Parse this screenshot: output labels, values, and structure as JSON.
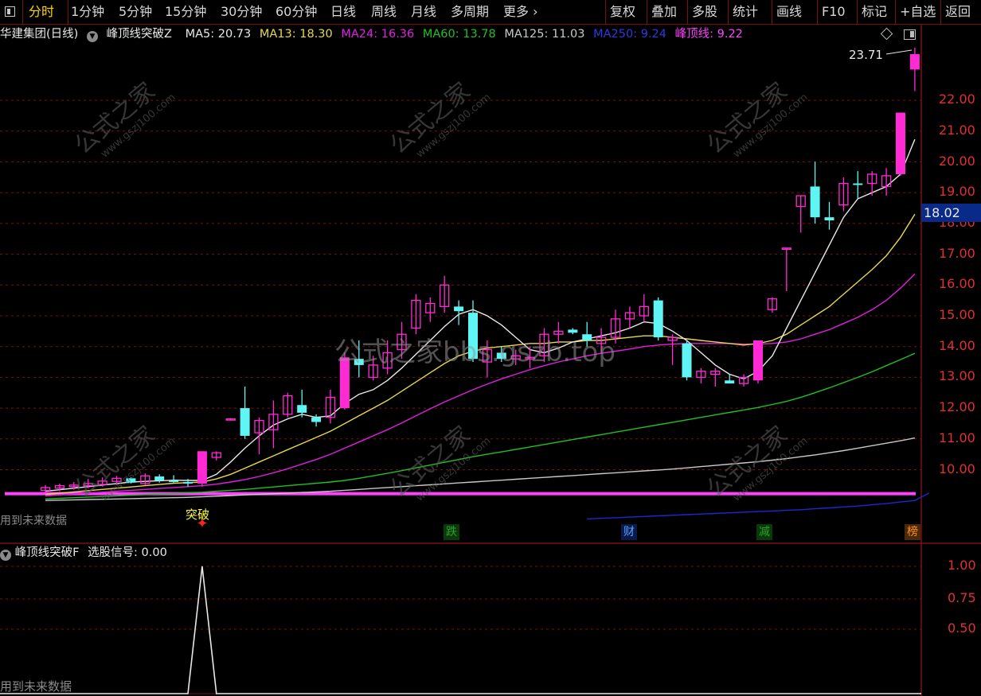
{
  "toolbar": {
    "items": [
      {
        "label": "分时",
        "active": true
      },
      {
        "label": "1分钟"
      },
      {
        "label": "5分钟"
      },
      {
        "label": "15分钟"
      },
      {
        "label": "30分钟"
      },
      {
        "label": "60分钟"
      },
      {
        "label": "日线"
      },
      {
        "label": "周线"
      },
      {
        "label": "月线"
      },
      {
        "label": "多周期"
      },
      {
        "label": "更多"
      }
    ],
    "more_arrow": "›",
    "right_items": [
      "复权",
      "叠加",
      "多股",
      "统计",
      "画线",
      "F10",
      "标记",
      "+自选",
      "返回"
    ]
  },
  "info": {
    "stock": "华建集团(日线)",
    "indicator": "峰顶线突破Z",
    "ma5": "MA5: 20.73",
    "ma13": "MA13: 18.30",
    "ma24": "MA24: 16.36",
    "ma60": "MA60: 13.78",
    "ma125": "MA125: 11.03",
    "ma250": "MA250: 9.24",
    "fengding": "峰顶线: 9.22",
    "dropdown_icon": "chevron-down"
  },
  "colors": {
    "up": "#ff2ad4",
    "down": "#5ff5f5",
    "ma5": "#e8e8e8",
    "ma13": "#e6d84a",
    "ma24": "#e020e0",
    "ma60": "#20c020",
    "ma125": "#c8c8c8",
    "ma250": "#1a2ad0",
    "fengding": "#ff40ff",
    "grid": "#7a1010",
    "axis": "#e03030"
  },
  "main_axis": {
    "labels": [
      "22.00",
      "21.00",
      "20.00",
      "19.00",
      "18.00",
      "17.00",
      "16.00",
      "15.00",
      "14.00",
      "13.00",
      "12.00",
      "11.00",
      "10.00"
    ],
    "current_price": "18.02"
  },
  "peak_label": "23.71",
  "breakout_label": "突破",
  "main_footnote": "用到未来数据",
  "news_badges": [
    {
      "text": "跌",
      "color": "#2ca02c",
      "bg": "#0a3a0a"
    },
    {
      "text": "财",
      "color": "#5aa0ff",
      "bg": "#0a1a4a"
    },
    {
      "text": "减",
      "color": "#2ca02c",
      "bg": "#0a3a0a"
    },
    {
      "text": "榜",
      "color": "#ff8c20",
      "bg": "#4a2a0a"
    }
  ],
  "sub": {
    "title": "峰顶线突破F",
    "signal": "选股信号: 0.00",
    "axis_labels": [
      "1.00",
      "0.75",
      "0.50"
    ],
    "footnote": "用到未来数据"
  },
  "watermark": {
    "center": "公式之家bbs.gszb.top",
    "diag_big": "公式之家",
    "diag_small": "www.gszj100.com"
  },
  "chart_data": {
    "type": "candlestick",
    "price_range": [
      9.0,
      23.71
    ],
    "candles": [
      {
        "o": 9.33,
        "h": 9.5,
        "l": 9.25,
        "c": 9.42
      },
      {
        "o": 9.4,
        "h": 9.55,
        "l": 9.3,
        "c": 9.48
      },
      {
        "o": 9.45,
        "h": 9.6,
        "l": 9.35,
        "c": 9.5
      },
      {
        "o": 9.48,
        "h": 9.7,
        "l": 9.4,
        "c": 9.55
      },
      {
        "o": 9.52,
        "h": 9.75,
        "l": 9.45,
        "c": 9.63
      },
      {
        "o": 9.62,
        "h": 9.8,
        "l": 9.5,
        "c": 9.72
      },
      {
        "o": 9.72,
        "h": 9.75,
        "l": 9.55,
        "c": 9.58
      },
      {
        "o": 9.55,
        "h": 9.88,
        "l": 9.5,
        "c": 9.8
      },
      {
        "o": 9.78,
        "h": 9.85,
        "l": 9.58,
        "c": 9.65
      },
      {
        "o": 9.65,
        "h": 9.82,
        "l": 9.58,
        "c": 9.6
      },
      {
        "o": 9.6,
        "h": 9.7,
        "l": 9.45,
        "c": 9.55
      },
      {
        "o": 9.55,
        "h": 10.6,
        "l": 9.45,
        "c": 10.6
      },
      {
        "o": 10.4,
        "h": 10.6,
        "l": 10.3,
        "c": 10.55
      },
      {
        "o": 11.65,
        "h": 11.68,
        "l": 11.6,
        "c": 11.65
      },
      {
        "o": 12.0,
        "h": 12.7,
        "l": 11.0,
        "c": 11.1
      },
      {
        "o": 11.2,
        "h": 11.7,
        "l": 10.5,
        "c": 11.6
      },
      {
        "o": 11.3,
        "h": 12.25,
        "l": 10.7,
        "c": 11.8
      },
      {
        "o": 11.8,
        "h": 12.5,
        "l": 11.7,
        "c": 12.4
      },
      {
        "o": 12.1,
        "h": 12.6,
        "l": 11.7,
        "c": 11.85
      },
      {
        "o": 11.7,
        "h": 11.8,
        "l": 11.4,
        "c": 11.55
      },
      {
        "o": 11.7,
        "h": 12.6,
        "l": 11.5,
        "c": 12.35
      },
      {
        "o": 12.0,
        "h": 13.8,
        "l": 11.95,
        "c": 13.65
      },
      {
        "o": 13.6,
        "h": 14.2,
        "l": 13.0,
        "c": 13.4
      },
      {
        "o": 13.0,
        "h": 13.7,
        "l": 12.9,
        "c": 13.4
      },
      {
        "o": 13.3,
        "h": 14.2,
        "l": 13.1,
        "c": 13.8
      },
      {
        "o": 13.9,
        "h": 14.8,
        "l": 13.6,
        "c": 14.4
      },
      {
        "o": 14.6,
        "h": 15.7,
        "l": 14.4,
        "c": 15.5
      },
      {
        "o": 15.1,
        "h": 15.6,
        "l": 14.8,
        "c": 15.4
      },
      {
        "o": 15.3,
        "h": 16.3,
        "l": 15.1,
        "c": 16.0
      },
      {
        "o": 15.3,
        "h": 15.5,
        "l": 14.7,
        "c": 15.15
      },
      {
        "o": 15.1,
        "h": 15.5,
        "l": 13.5,
        "c": 13.6
      },
      {
        "o": 13.5,
        "h": 14.2,
        "l": 13.0,
        "c": 13.9
      },
      {
        "o": 13.8,
        "h": 14.0,
        "l": 13.5,
        "c": 13.6
      },
      {
        "o": 13.6,
        "h": 13.9,
        "l": 13.4,
        "c": 13.7
      },
      {
        "o": 13.6,
        "h": 14.0,
        "l": 13.3,
        "c": 13.65
      },
      {
        "o": 13.7,
        "h": 14.6,
        "l": 13.5,
        "c": 14.4
      },
      {
        "o": 14.4,
        "h": 14.8,
        "l": 14.1,
        "c": 14.5
      },
      {
        "o": 14.55,
        "h": 14.6,
        "l": 14.4,
        "c": 14.45
      },
      {
        "o": 14.4,
        "h": 14.8,
        "l": 14.0,
        "c": 14.2
      },
      {
        "o": 14.1,
        "h": 14.6,
        "l": 13.8,
        "c": 14.3
      },
      {
        "o": 14.3,
        "h": 15.2,
        "l": 14.1,
        "c": 14.9
      },
      {
        "o": 14.9,
        "h": 15.3,
        "l": 14.6,
        "c": 15.1
      },
      {
        "o": 15.0,
        "h": 15.7,
        "l": 14.8,
        "c": 15.3
      },
      {
        "o": 15.5,
        "h": 15.6,
        "l": 14.2,
        "c": 14.3
      },
      {
        "o": 14.2,
        "h": 14.4,
        "l": 13.4,
        "c": 14.3
      },
      {
        "o": 14.1,
        "h": 14.2,
        "l": 12.9,
        "c": 13.0
      },
      {
        "o": 13.0,
        "h": 13.3,
        "l": 12.8,
        "c": 13.2
      },
      {
        "o": 13.1,
        "h": 13.3,
        "l": 12.7,
        "c": 13.2
      },
      {
        "o": 12.9,
        "h": 13.1,
        "l": 12.8,
        "c": 12.8
      },
      {
        "o": 12.8,
        "h": 13.1,
        "l": 12.7,
        "c": 13.0
      },
      {
        "o": 12.9,
        "h": 14.2,
        "l": 12.8,
        "c": 14.2
      },
      {
        "o": 15.2,
        "h": 15.6,
        "l": 15.1,
        "c": 15.55
      },
      {
        "o": 17.2,
        "h": 17.2,
        "l": 15.8,
        "c": 17.2
      },
      {
        "o": 18.55,
        "h": 18.9,
        "l": 17.7,
        "c": 18.9
      },
      {
        "o": 19.2,
        "h": 20.0,
        "l": 18.0,
        "c": 18.2
      },
      {
        "o": 18.2,
        "h": 18.7,
        "l": 17.8,
        "c": 18.1
      },
      {
        "o": 18.6,
        "h": 19.5,
        "l": 18.4,
        "c": 19.3
      },
      {
        "o": 19.3,
        "h": 19.7,
        "l": 18.8,
        "c": 19.25
      },
      {
        "o": 19.3,
        "h": 19.7,
        "l": 18.9,
        "c": 19.6
      },
      {
        "o": 19.2,
        "h": 19.8,
        "l": 18.9,
        "c": 19.55
      },
      {
        "o": 19.6,
        "h": 21.6,
        "l": 19.55,
        "c": 21.6
      },
      {
        "o": 23.0,
        "h": 23.71,
        "l": 22.3,
        "c": 23.5
      }
    ],
    "ma": {
      "ma5": [
        9.3,
        9.35,
        9.4,
        9.45,
        9.5,
        9.55,
        9.6,
        9.62,
        9.64,
        9.66,
        9.65,
        9.65,
        9.85,
        10.25,
        10.7,
        11.1,
        11.45,
        11.65,
        11.8,
        11.7,
        11.75,
        12.15,
        12.45,
        12.6,
        12.9,
        13.3,
        13.75,
        14.2,
        14.65,
        15.05,
        15.2,
        15.0,
        14.7,
        14.3,
        13.9,
        13.8,
        13.95,
        14.15,
        14.25,
        14.35,
        14.45,
        14.6,
        14.8,
        14.75,
        14.5,
        14.2,
        13.8,
        13.4,
        13.1,
        12.95,
        13.2,
        13.7,
        14.6,
        15.5,
        16.4,
        17.3,
        18.2,
        18.8,
        19.0,
        19.2,
        19.6,
        20.73
      ],
      "ma13": [
        9.2,
        9.24,
        9.28,
        9.32,
        9.36,
        9.4,
        9.44,
        9.48,
        9.52,
        9.56,
        9.58,
        9.6,
        9.7,
        9.85,
        10.05,
        10.25,
        10.45,
        10.65,
        10.85,
        11.05,
        11.25,
        11.5,
        11.75,
        12.0,
        12.25,
        12.55,
        12.85,
        13.15,
        13.45,
        13.7,
        13.85,
        13.95,
        14.0,
        14.05,
        14.1,
        14.1,
        14.15,
        14.15,
        14.2,
        14.2,
        14.25,
        14.3,
        14.35,
        14.35,
        14.3,
        14.25,
        14.2,
        14.15,
        14.1,
        14.05,
        14.1,
        14.2,
        14.4,
        14.7,
        15.0,
        15.3,
        15.7,
        16.1,
        16.5,
        16.95,
        17.55,
        18.3
      ],
      "ma24": [
        9.15,
        9.18,
        9.21,
        9.24,
        9.27,
        9.3,
        9.33,
        9.36,
        9.39,
        9.42,
        9.45,
        9.48,
        9.53,
        9.6,
        9.68,
        9.78,
        9.9,
        10.03,
        10.18,
        10.33,
        10.5,
        10.7,
        10.9,
        11.1,
        11.3,
        11.52,
        11.75,
        11.98,
        12.2,
        12.4,
        12.6,
        12.78,
        12.95,
        13.1,
        13.25,
        13.38,
        13.5,
        13.6,
        13.7,
        13.78,
        13.85,
        13.92,
        14.0,
        14.05,
        14.08,
        14.1,
        14.1,
        14.1,
        14.1,
        14.08,
        14.08,
        14.1,
        14.15,
        14.25,
        14.4,
        14.55,
        14.75,
        14.95,
        15.2,
        15.5,
        15.9,
        16.36
      ],
      "ma60": [
        9.05,
        9.07,
        9.09,
        9.11,
        9.13,
        9.15,
        9.17,
        9.19,
        9.21,
        9.23,
        9.25,
        9.27,
        9.3,
        9.33,
        9.36,
        9.4,
        9.44,
        9.48,
        9.52,
        9.56,
        9.6,
        9.65,
        9.72,
        9.8,
        9.88,
        9.97,
        10.06,
        10.15,
        10.24,
        10.33,
        10.42,
        10.5,
        10.58,
        10.66,
        10.74,
        10.82,
        10.9,
        10.98,
        11.06,
        11.14,
        11.22,
        11.3,
        11.38,
        11.46,
        11.54,
        11.62,
        11.7,
        11.78,
        11.86,
        11.94,
        12.02,
        12.12,
        12.22,
        12.35,
        12.5,
        12.66,
        12.83,
        13.0,
        13.18,
        13.38,
        13.58,
        13.78
      ],
      "ma125": [
        9.0,
        9.01,
        9.02,
        9.03,
        9.04,
        9.05,
        9.06,
        9.07,
        9.08,
        9.09,
        9.1,
        9.12,
        9.14,
        9.16,
        9.18,
        9.2,
        9.22,
        9.24,
        9.26,
        9.28,
        9.3,
        9.33,
        9.36,
        9.39,
        9.42,
        9.45,
        9.48,
        9.51,
        9.54,
        9.57,
        9.6,
        9.63,
        9.66,
        9.69,
        9.72,
        9.75,
        9.78,
        9.81,
        9.84,
        9.87,
        9.9,
        9.93,
        9.96,
        9.99,
        10.02,
        10.06,
        10.1,
        10.14,
        10.18,
        10.22,
        10.26,
        10.31,
        10.36,
        10.42,
        10.48,
        10.55,
        10.62,
        10.7,
        10.78,
        10.86,
        10.94,
        11.03
      ],
      "ma250_start_index": 38,
      "ma250": [
        8.4,
        8.42,
        8.44,
        8.46,
        8.48,
        8.5,
        8.52,
        8.54,
        8.56,
        8.58,
        8.6,
        8.62,
        8.64,
        8.66,
        8.68,
        8.7,
        8.73,
        8.76,
        8.79,
        8.82,
        8.86,
        8.9,
        8.95,
        9.0,
        9.24
      ],
      "fengding": 9.22
    },
    "signal": {
      "type": "line",
      "values": [
        0,
        0,
        0,
        0,
        0,
        0,
        0,
        0,
        0,
        0,
        0,
        1,
        0,
        0,
        0,
        0,
        0,
        0,
        0,
        0,
        0,
        0,
        0,
        0,
        0,
        0,
        0,
        0,
        0,
        0,
        0,
        0,
        0,
        0,
        0,
        0,
        0,
        0,
        0,
        0,
        0,
        0,
        0,
        0,
        0,
        0,
        0,
        0,
        0,
        0,
        0,
        0,
        0,
        0,
        0,
        0,
        0,
        0,
        0,
        0,
        0,
        0
      ],
      "ylim": [
        0,
        1.2
      ]
    }
  }
}
